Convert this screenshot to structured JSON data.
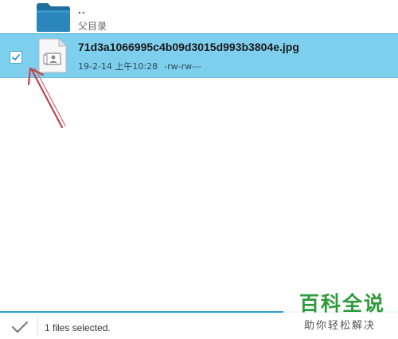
{
  "file_list": {
    "parent": {
      "name": "..",
      "subtitle": "父目录",
      "icon": "folder-icon"
    },
    "selected_file": {
      "name": "71d3a1066995c4b09d3015d993b3804e.jpg",
      "date": "19-2-14 上午10:28",
      "permissions": "-rw-rw---",
      "checked": true,
      "icon": "image-file-icon"
    }
  },
  "bottom_bar": {
    "status": "1 files selected.",
    "confirm_icon": "checkmark-icon"
  },
  "watermark": {
    "main": "百科全说",
    "sub": "助你轻松解决"
  },
  "colors": {
    "selection_bg": "#7ecfee",
    "accent": "#2f9cd6",
    "folder": "#2a86bb",
    "annotation_arrow": "#c0444c",
    "watermark_green": "#2e9a3c"
  }
}
